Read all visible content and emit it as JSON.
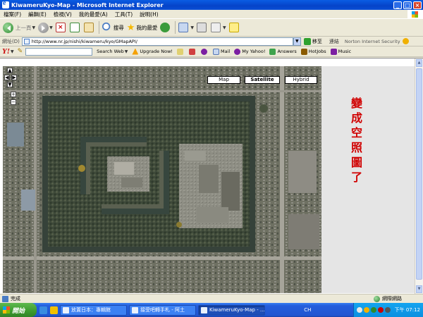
{
  "window": {
    "title": "KiwameruKyo-Map - Microsoft Internet Explorer"
  },
  "menu": {
    "items": [
      "檔案(F)",
      "編輯(E)",
      "檢視(V)",
      "我的最愛(A)",
      "工具(T)",
      "說明(H)"
    ]
  },
  "toolbar": {
    "back_label": "上一頁",
    "search_label": "搜尋",
    "favorites_label": "我的最愛"
  },
  "address": {
    "label": "網址(D)",
    "url": "http://www.nr.jp/nishi/kiwameru/kyo/GMapAPI/",
    "go_label": "移至",
    "links_label": "連結",
    "norton_label": "Norton Internet Security"
  },
  "yahoo": {
    "logo": "Y!",
    "search_web_label": "Search Web",
    "upgrade_label": "Upgrade Now!",
    "mail_label": "Mail",
    "myyahoo_label": "My Yahoo!",
    "answers_label": "Answers",
    "hotjobs_label": "HotJobs",
    "music_label": "Music"
  },
  "map": {
    "types": [
      "Map",
      "Satellite",
      "Hybrid"
    ],
    "active_type": "Satellite",
    "zoom_in": "+",
    "zoom_out": "−"
  },
  "sidebar": {
    "text": "變成空照圖了"
  },
  "status": {
    "text": "完成",
    "zone": "網際網路"
  },
  "taskbar": {
    "start_label": "開始",
    "tasks": [
      "放置日本：專輯館",
      "接受吧轉手札 - 阿土",
      "KiwameruKyo-Map - ..."
    ],
    "lang": "CH",
    "clock": "下午 07:12"
  },
  "colors": {
    "sidebar_text": "#D00000",
    "titlebar": "#0543C8"
  }
}
